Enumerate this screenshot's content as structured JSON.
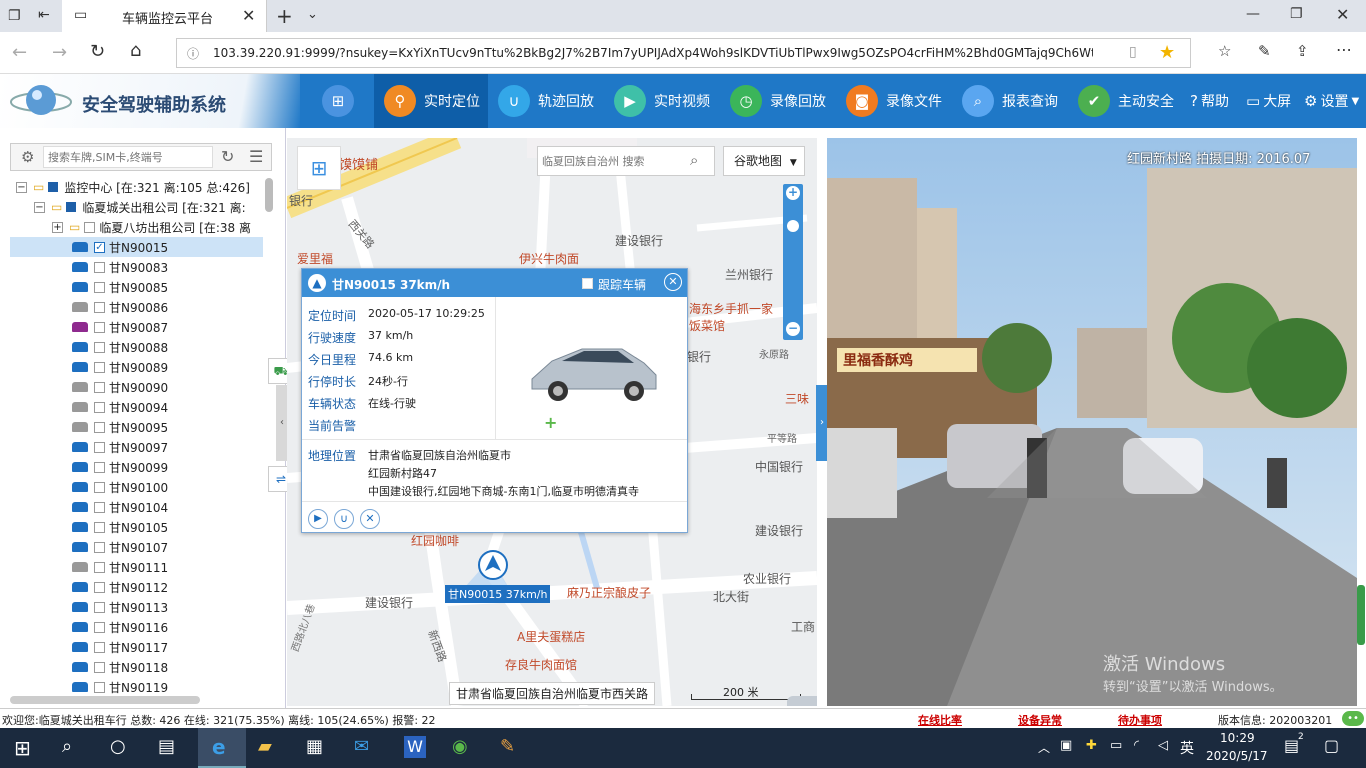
{
  "browser": {
    "tab_title": "车辆监控云平台",
    "url": "103.39.220.91:9999/?nsukey=KxYiXnTUcv9nTtu%2BkBg2J7%2B7Im7yUPIJAdXp4Woh9slKDVTiUbTlPwx9Iwg5OZsPO4crFiHM%2Bhd0GMTajq9Ch6Wtj451CSNtfffi7f"
  },
  "app": {
    "system_name": "安全驾驶辅助系统",
    "nav": [
      {
        "label": "实时定位",
        "color": "#f08a24"
      },
      {
        "label": "轨迹回放",
        "color": "#33a7e8"
      },
      {
        "label": "实时视频",
        "color": "#3fc0a8"
      },
      {
        "label": "录像回放",
        "color": "#3bb55a"
      },
      {
        "label": "录像文件",
        "color": "#f07b20"
      },
      {
        "label": "报表查询",
        "color": "#5aa6f0"
      },
      {
        "label": "主动安全",
        "color": "#4caf50"
      }
    ],
    "help": "帮助",
    "bigscreen": "大屏",
    "settings": "设置"
  },
  "left": {
    "search_placeholder": "搜索车牌,SIM卡,终端号",
    "tree": [
      {
        "label": "监控中心 [在:321 离:105 总:426]"
      },
      {
        "label": "临夏城关出租公司 [在:321 离:"
      },
      {
        "label": "临夏八坊出租公司 [在:38 离"
      }
    ],
    "vehicles": [
      {
        "plate": "甘N90015",
        "color": "#1e6fc0",
        "checked": true
      },
      {
        "plate": "甘N90083",
        "color": "#1e6fc0"
      },
      {
        "plate": "甘N90085",
        "color": "#1e6fc0"
      },
      {
        "plate": "甘N90086",
        "color": "#999999"
      },
      {
        "plate": "甘N90087",
        "color": "#8e2a8e"
      },
      {
        "plate": "甘N90088",
        "color": "#1e6fc0"
      },
      {
        "plate": "甘N90089",
        "color": "#1e6fc0"
      },
      {
        "plate": "甘N90090",
        "color": "#999999"
      },
      {
        "plate": "甘N90094",
        "color": "#999999"
      },
      {
        "plate": "甘N90095",
        "color": "#999999"
      },
      {
        "plate": "甘N90097",
        "color": "#1e6fc0"
      },
      {
        "plate": "甘N90099",
        "color": "#1e6fc0"
      },
      {
        "plate": "甘N90100",
        "color": "#1e6fc0"
      },
      {
        "plate": "甘N90104",
        "color": "#1e6fc0"
      },
      {
        "plate": "甘N90105",
        "color": "#1e6fc0"
      },
      {
        "plate": "甘N90107",
        "color": "#1e6fc0"
      },
      {
        "plate": "甘N90111",
        "color": "#999999"
      },
      {
        "plate": "甘N90112",
        "color": "#1e6fc0"
      },
      {
        "plate": "甘N90113",
        "color": "#1e6fc0"
      },
      {
        "plate": "甘N90116",
        "color": "#1e6fc0"
      },
      {
        "plate": "甘N90117",
        "color": "#1e6fc0"
      },
      {
        "plate": "甘N90118",
        "color": "#1e6fc0"
      },
      {
        "plate": "甘N90119",
        "color": "#1e6fc0"
      }
    ]
  },
  "map": {
    "search_placeholder": "临夏回族自治州 搜索",
    "map_type": "谷歌地图",
    "labels": [
      "馍馍铺",
      "西关路",
      "爱里福",
      "伊兴牛肉面",
      "建设银行",
      "兰州银行",
      "海东乡手抓一家饭菜馆",
      "永原路",
      "银行",
      "三味",
      "平等路",
      "中国银行",
      "建设银行",
      "红园咖啡",
      "麻乃正宗酿皮子",
      "北大街",
      "农业银行",
      "建设银行",
      "A里夫蛋糕店",
      "工商",
      "存良牛肉面馆",
      "新西路",
      "西路北八巷",
      "银行"
    ],
    "vehicle_label": "甘N90015 37km/h",
    "bottom_address": "甘肃省临夏回族自治州临夏市西关路",
    "scale": "200 米"
  },
  "popup": {
    "title": "甘N90015 37km/h",
    "follow": "跟踪车辆",
    "rows": [
      {
        "label": "定位时间",
        "value": "2020-05-17 10:29:25"
      },
      {
        "label": "行驶速度",
        "value": "37 km/h"
      },
      {
        "label": "今日里程",
        "value": "74.6 km"
      },
      {
        "label": "行停时长",
        "value": "24秒-行"
      },
      {
        "label": "车辆状态",
        "value": "在线-行驶"
      },
      {
        "label": "当前告警",
        "value": ""
      }
    ],
    "geo_label": "地理位置",
    "geo_lines": [
      "甘肃省临夏回族自治州临夏市",
      "红园新村路47",
      "中国建设银行,红园地下商城-东南1门,临夏市明德清真寺"
    ]
  },
  "photo": {
    "caption": "红园新村路 拍摄日期: 2016.07",
    "shop_sign": "里福香酥鸡",
    "watermark_1": "激活 Windows",
    "watermark_2": "转到“设置”以激活 Windows。"
  },
  "status": {
    "summary": "欢迎您:临夏城关出租车行 总数: 426 在线: 321(75.35%) 离线: 105(24.65%) 报警: 22",
    "online_ratio": "在线比率",
    "device_error": "设备异常",
    "pending": "待办事项",
    "version": "版本信息: 202003201"
  },
  "taskbar": {
    "lang": "英",
    "time": "10:29",
    "date": "2020/5/17",
    "notify_count": "2"
  }
}
